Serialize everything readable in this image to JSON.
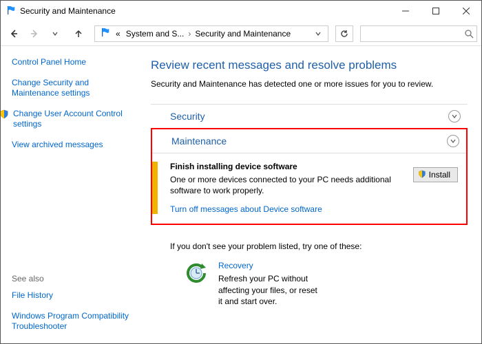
{
  "window": {
    "title": "Security and Maintenance"
  },
  "breadcrumb": {
    "level1": "System and S...",
    "level2": "Security and Maintenance"
  },
  "search": {
    "placeholder": ""
  },
  "sidebar": {
    "home": "Control Panel Home",
    "change_sec": "Change Security and Maintenance settings",
    "change_uac": "Change User Account Control settings",
    "view_archived": "View archived messages"
  },
  "seealso": {
    "heading": "See also",
    "file_history": "File History",
    "win_prog": "Windows Program Compatibility Troubleshooter"
  },
  "main": {
    "heading": "Review recent messages and resolve problems",
    "subtext": "Security and Maintenance has detected one or more issues for you to review."
  },
  "panels": {
    "security": "Security",
    "maintenance": "Maintenance"
  },
  "alert": {
    "title": "Finish installing device software",
    "desc": "One or more devices connected to your PC needs additional software to work properly.",
    "turn_off": "Turn off messages about Device software",
    "install": "Install"
  },
  "notlisted": "If you don't see your problem listed, try one of these:",
  "recovery": {
    "title": "Recovery",
    "desc": "Refresh your PC without affecting your files, or reset it and start over."
  }
}
